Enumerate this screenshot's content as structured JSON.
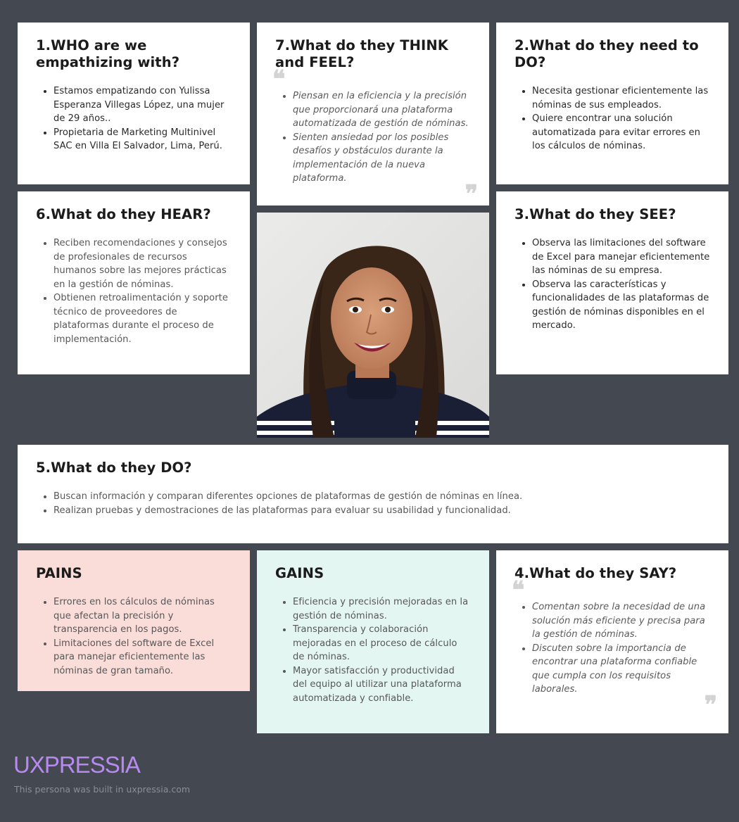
{
  "cards": {
    "who": {
      "title": "1.WHO are we empathizing with?",
      "items": [
        "Estamos empatizando con Yulissa Esperanza Villegas López, una mujer de 29 años..",
        "Propietaria de Marketing Multinivel SAC en Villa El Salvador, Lima, Perú."
      ]
    },
    "think": {
      "title": "7.What do they THINK and FEEL?",
      "items": [
        "Piensan en la eficiencia y la precisión que proporcionará una plataforma automatizada de gestión de nóminas.",
        "Sienten ansiedad por los posibles desafíos y obstáculos durante la implementación de la nueva plataforma."
      ]
    },
    "need": {
      "title": "2.What do they need to DO?",
      "items": [
        "Necesita gestionar eficientemente las nóminas de sus empleados.",
        "Quiere encontrar una solución automatizada para evitar errores en los cálculos de nóminas."
      ]
    },
    "hear": {
      "title": "6.What do they HEAR?",
      "items": [
        "Reciben recomendaciones y consejos de profesionales de recursos humanos sobre las mejores prácticas en la gestión de nóminas.",
        "Obtienen retroalimentación y soporte técnico de proveedores de plataformas durante el proceso de implementación."
      ]
    },
    "see": {
      "title": "3.What do they SEE?",
      "items": [
        "Observa las limitaciones del software de Excel para manejar eficientemente las nóminas de su empresa.",
        "Observa las características y funcionalidades de las plataformas de gestión de nóminas disponibles en el mercado."
      ]
    },
    "do": {
      "title": "5.What do they DO?",
      "items": [
        "Buscan información y comparan diferentes opciones de plataformas de gestión de nóminas en línea.",
        "Realizan pruebas y demostraciones de las plataformas para evaluar su usabilidad y funcionalidad."
      ]
    },
    "pains": {
      "title": "PAINS",
      "items": [
        "Errores en los cálculos de nóminas que afectan la precisión y transparencia en los pagos.",
        "Limitaciones del software de Excel para manejar eficientemente las nóminas de gran tamaño."
      ]
    },
    "gains": {
      "title": "GAINS",
      "items": [
        "Eficiencia y precisión mejoradas en la gestión de nóminas.",
        "Transparencia y colaboración mejoradas en el proceso de cálculo de nóminas.",
        "Mayor satisfacción y productividad del equipo al utilizar una plataforma automatizada y confiable."
      ]
    },
    "say": {
      "title": "4.What do they SAY?",
      "items": [
        "Comentan sobre la necesidad de una solución más eficiente y precisa para la gestión de nóminas.",
        "Discuten sobre la importancia de encontrar una plataforma confiable que cumpla con los requisitos laborales."
      ]
    }
  },
  "quote_open": "❝",
  "quote_close": "❞",
  "footer": {
    "brand": "UXPRESSIA",
    "note": "This persona was built in uxpressia.com"
  },
  "colors": {
    "background": "#434851",
    "card": "#ffffff",
    "pains": "#fadcd8",
    "gains": "#e4f6f2",
    "brand": "#b889f0"
  }
}
